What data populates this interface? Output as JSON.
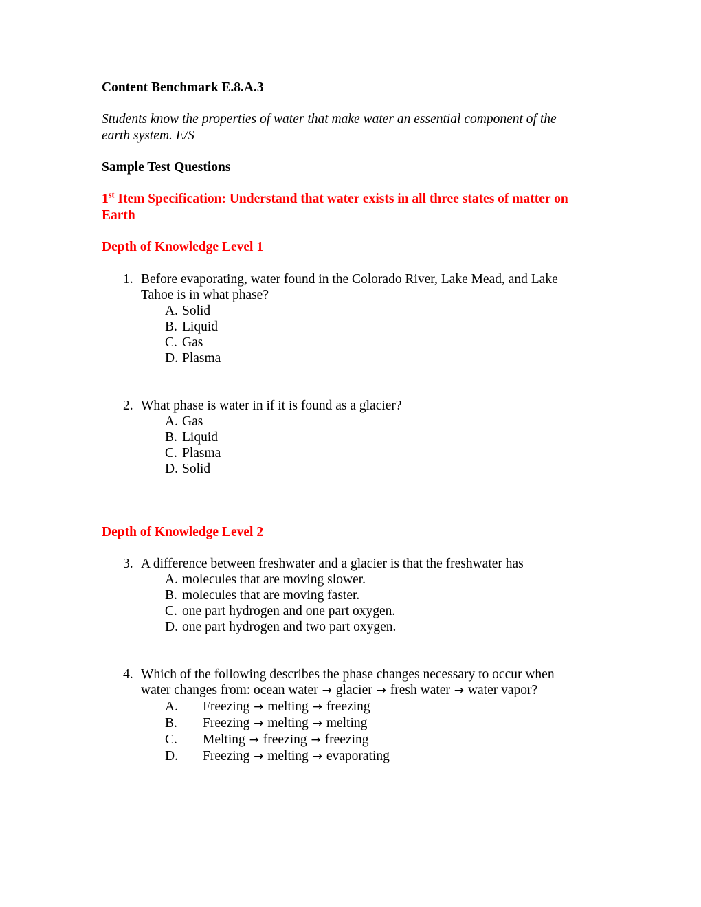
{
  "document": {
    "title": "Content Benchmark E.8.A.3",
    "benchmark_statement": "Students know the properties of water that make water an essential component of the earth system. E/S",
    "sample_test_questions_heading": "Sample Test Questions",
    "accent_color": "#FF0000",
    "text_color": "#000000",
    "background_color": "#FFFFFF"
  },
  "item_specification": {
    "ordinal_number": "1",
    "ordinal_suffix": "st",
    "label": " Item Specification: Understand that water exists in all three states of matter on Earth"
  },
  "sections": [
    {
      "heading": "Depth of Knowledge Level 1",
      "questions": [
        {
          "number": "1.",
          "text": "Before evaporating, water found in the Colorado River, Lake Mead, and Lake Tahoe is in what phase?",
          "options": [
            {
              "letter": "A.",
              "text": "Solid"
            },
            {
              "letter": "B.",
              "text": "Liquid"
            },
            {
              "letter": "C.",
              "text": "Gas"
            },
            {
              "letter": "D.",
              "text": "Plasma"
            }
          ]
        },
        {
          "number": "2.",
          "text": "What phase is water in if it is found as a glacier?",
          "options": [
            {
              "letter": "A.",
              "text": "Gas"
            },
            {
              "letter": "B.",
              "text": "Liquid"
            },
            {
              "letter": "C.",
              "text": "Plasma"
            },
            {
              "letter": "D.",
              "text": "Solid"
            }
          ]
        }
      ]
    },
    {
      "heading": "Depth of Knowledge Level 2",
      "questions": [
        {
          "number": "3.",
          "text": "A difference between freshwater and a glacier is that the freshwater has",
          "options": [
            {
              "letter": "A.",
              "text": "molecules that are moving slower."
            },
            {
              "letter": "B.",
              "text": "molecules that are moving faster."
            },
            {
              "letter": "C.",
              "text": "one part hydrogen and one part oxygen."
            },
            {
              "letter": "D.",
              "text": "one part hydrogen and two part oxygen."
            }
          ]
        },
        {
          "number": "4.",
          "text_part_1": "Which of the following describes the phase changes necessary to occur when water changes from: ocean water ",
          "text_part_2": " glacier ",
          "text_part_3": " fresh water ",
          "text_part_4": " water vapor?",
          "arrow_glyph": "→",
          "options": [
            {
              "letter": "A.",
              "step1": "Freezing ",
              "step2": " melting ",
              "step3": " freezing"
            },
            {
              "letter": "B.",
              "step1": "Freezing ",
              "step2": " melting ",
              "step3": " melting"
            },
            {
              "letter": "C.",
              "step1": "Melting ",
              "step2": " freezing ",
              "step3": " freezing"
            },
            {
              "letter": "D.",
              "step1": "Freezing ",
              "step2": " melting ",
              "step3": " evaporating"
            }
          ]
        }
      ]
    }
  ]
}
